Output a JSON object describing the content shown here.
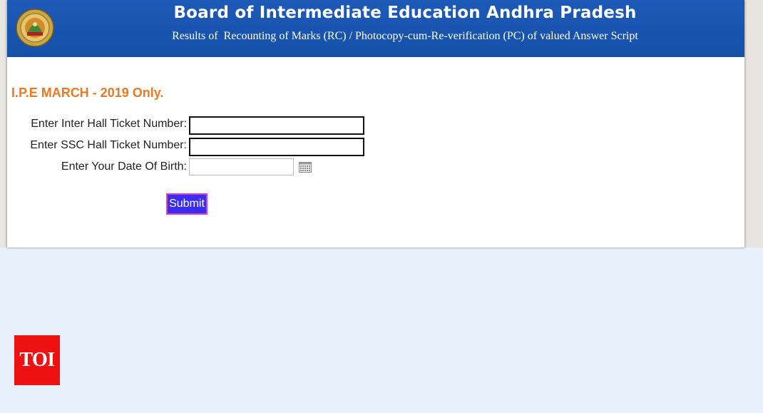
{
  "header": {
    "title": "Board of Intermediate Education Andhra Pradesh",
    "subtitle": "Results of  Recounting of Marks (RC) / Photocopy-cum-Re-verification (PC) of valued Answer Script"
  },
  "form": {
    "exam_title": "I.P.E MARCH - 2019 Only.",
    "inter_label": "Enter Inter Hall Ticket Number:",
    "inter_value": "",
    "ssc_label": "Enter SSC Hall Ticket Number:",
    "ssc_value": "",
    "dob_label": "Enter Your Date Of Birth:",
    "dob_value": "",
    "submit_label": "Submit"
  },
  "watermark": {
    "text": "TOI"
  },
  "colors": {
    "header_blue": "#1550a8",
    "exam_title_orange": "#f07820",
    "submit_bg": "#3a2cf0",
    "submit_border": "#e040c8",
    "toi_red": "#ee1111",
    "page_bg": "#e8f0fb"
  },
  "icons": {
    "logo": "emblem-logo-icon",
    "calendar": "calendar-icon"
  }
}
